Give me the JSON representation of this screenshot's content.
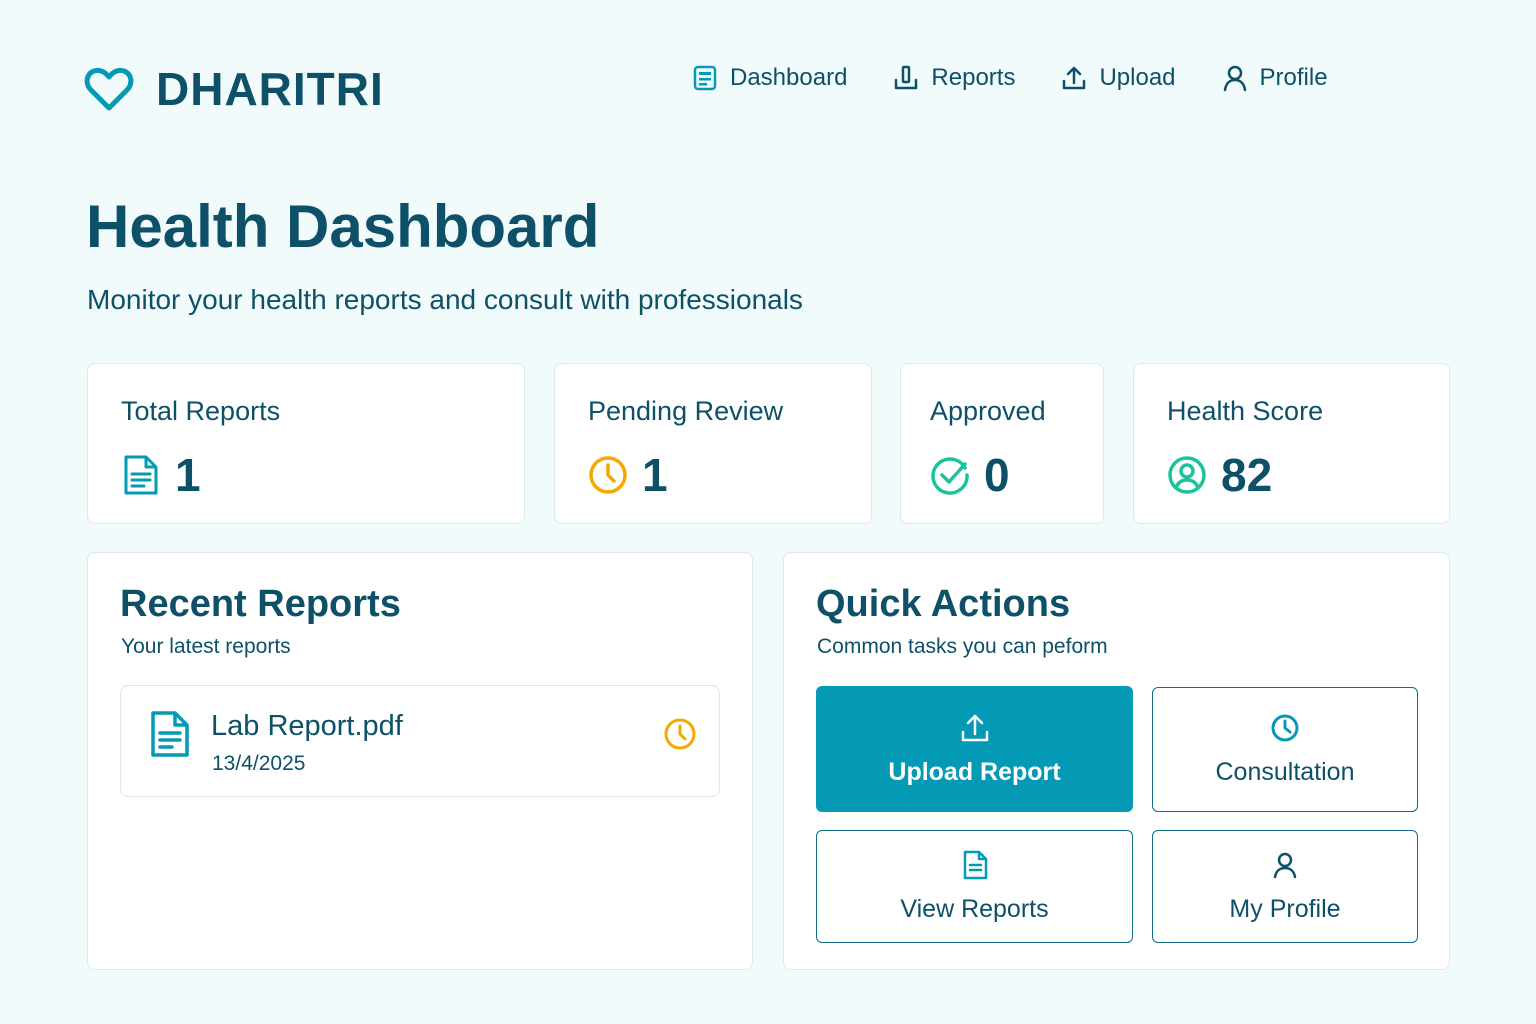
{
  "brand": {
    "name": "DHARITRI",
    "icon": "heart-icon",
    "color": "#0499b4"
  },
  "nav": {
    "items": [
      {
        "label": "Dashboard",
        "icon": "dashboard-icon"
      },
      {
        "label": "Reports",
        "icon": "reports-icon"
      },
      {
        "label": "Upload",
        "icon": "upload-icon"
      },
      {
        "label": "Profile",
        "icon": "user-icon"
      }
    ]
  },
  "page": {
    "title": "Health Dashboard",
    "subtitle": "Monitor your health reports and consult with professionals"
  },
  "stats": [
    {
      "label": "Total Reports",
      "value": "1",
      "icon": "document-icon",
      "color": "#0499b4"
    },
    {
      "label": "Pending Review",
      "value": "1",
      "icon": "clock-icon",
      "color": "#f2a900"
    },
    {
      "label": "Approved",
      "value": "0",
      "icon": "check-circle-icon",
      "color": "#19c49c"
    },
    {
      "label": "Health Score",
      "value": "82",
      "icon": "user-icon",
      "color": "#19c49c"
    }
  ],
  "recent_reports": {
    "title": "Recent Reports",
    "subtitle": "Your latest reports",
    "items": [
      {
        "name": "Lab Report.pdf",
        "date": "13/4/2025",
        "status_icon": "clock-icon"
      }
    ]
  },
  "quick_actions": {
    "title": "Quick Actions",
    "subtitle": "Common tasks you can peform",
    "buttons": [
      {
        "label": "Upload Report",
        "icon": "upload-icon"
      },
      {
        "label": "Consultation",
        "icon": "clock-icon"
      },
      {
        "label": "View Reports",
        "icon": "document-icon"
      },
      {
        "label": "My Profile",
        "icon": "user-icon"
      }
    ]
  },
  "colors": {
    "primary": "#0499b4",
    "text": "#0d5068",
    "pending": "#f2a900",
    "approved": "#19c49c",
    "background": "#f1fbfb"
  }
}
